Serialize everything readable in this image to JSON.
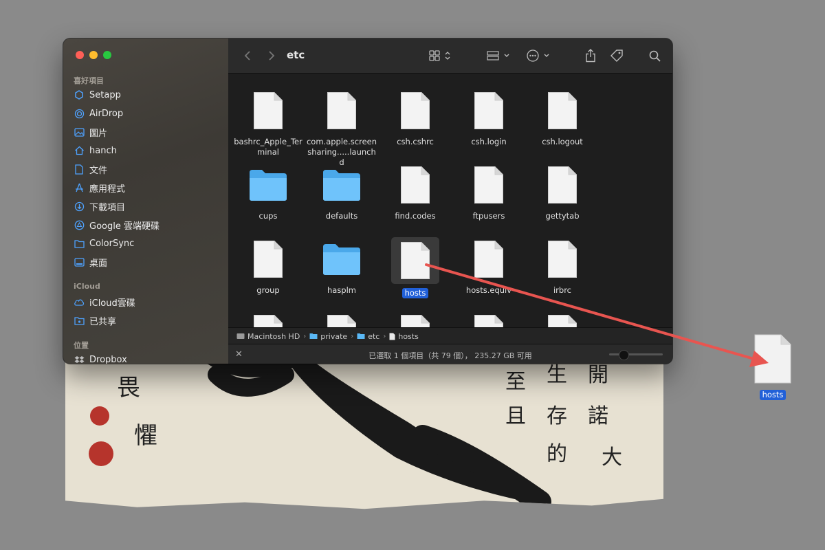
{
  "window": {
    "title": "etc"
  },
  "sidebar": {
    "sections": [
      {
        "label": "喜好項目",
        "items": [
          {
            "label": "Setapp",
            "icon": "setapp-icon"
          },
          {
            "label": "AirDrop",
            "icon": "airdrop-icon"
          },
          {
            "label": "圖片",
            "icon": "pictures-icon"
          },
          {
            "label": "hanch",
            "icon": "home-icon"
          },
          {
            "label": "文件",
            "icon": "document-icon"
          },
          {
            "label": "應用程式",
            "icon": "applications-icon"
          },
          {
            "label": "下載項目",
            "icon": "downloads-icon"
          },
          {
            "label": "Google 雲端硬碟",
            "icon": "google-drive-icon"
          },
          {
            "label": "ColorSync",
            "icon": "folder-icon"
          },
          {
            "label": "桌面",
            "icon": "desktop-icon"
          }
        ]
      },
      {
        "label": "iCloud",
        "items": [
          {
            "label": "iCloud雲碟",
            "icon": "icloud-icon"
          },
          {
            "label": "已共享",
            "icon": "shared-folder-icon"
          }
        ]
      },
      {
        "label": "位置",
        "items": [
          {
            "label": "Dropbox",
            "icon": "dropbox-icon"
          }
        ]
      }
    ]
  },
  "files": [
    {
      "name": "bashrc_Apple_Terminal",
      "display": "bashrc_Apple_Ter minal",
      "kind": "file"
    },
    {
      "name": "com.apple.screensharing.....launchd",
      "display": "com.apple.screen sharing.....launchd",
      "kind": "file"
    },
    {
      "name": "csh.cshrc",
      "display": "csh.cshrc",
      "kind": "file"
    },
    {
      "name": "csh.login",
      "display": "csh.login",
      "kind": "file"
    },
    {
      "name": "csh.logout",
      "display": "csh.logout",
      "kind": "file"
    },
    {
      "name": "cups",
      "display": "cups",
      "kind": "folder"
    },
    {
      "name": "defaults",
      "display": "defaults",
      "kind": "folder"
    },
    {
      "name": "find.codes",
      "display": "find.codes",
      "kind": "file"
    },
    {
      "name": "ftpusers",
      "display": "ftpusers",
      "kind": "file"
    },
    {
      "name": "gettytab",
      "display": "gettytab",
      "kind": "file"
    },
    {
      "name": "group",
      "display": "group",
      "kind": "file"
    },
    {
      "name": "hasplm",
      "display": "hasplm",
      "kind": "folder"
    },
    {
      "name": "hosts",
      "display": "hosts",
      "kind": "file",
      "selected": true
    },
    {
      "name": "hosts.equiv",
      "display": "hosts.equiv",
      "kind": "file"
    },
    {
      "name": "irbrc",
      "display": "irbrc",
      "kind": "file"
    }
  ],
  "pathbar": {
    "segments": [
      {
        "label": "Macintosh HD",
        "icon": "hard-drive-icon"
      },
      {
        "label": "private",
        "icon": "folder-icon"
      },
      {
        "label": "etc",
        "icon": "folder-icon"
      },
      {
        "label": "hosts",
        "icon": "file-icon"
      }
    ]
  },
  "status": {
    "text": "已選取 1 個項目（共 79 個）， 235.27 GB 可用"
  },
  "desktop": {
    "dragged_file": "hosts"
  },
  "colors": {
    "selection": "#2160d8",
    "folder": "#5ab8f5",
    "arrow": "#e85550"
  }
}
